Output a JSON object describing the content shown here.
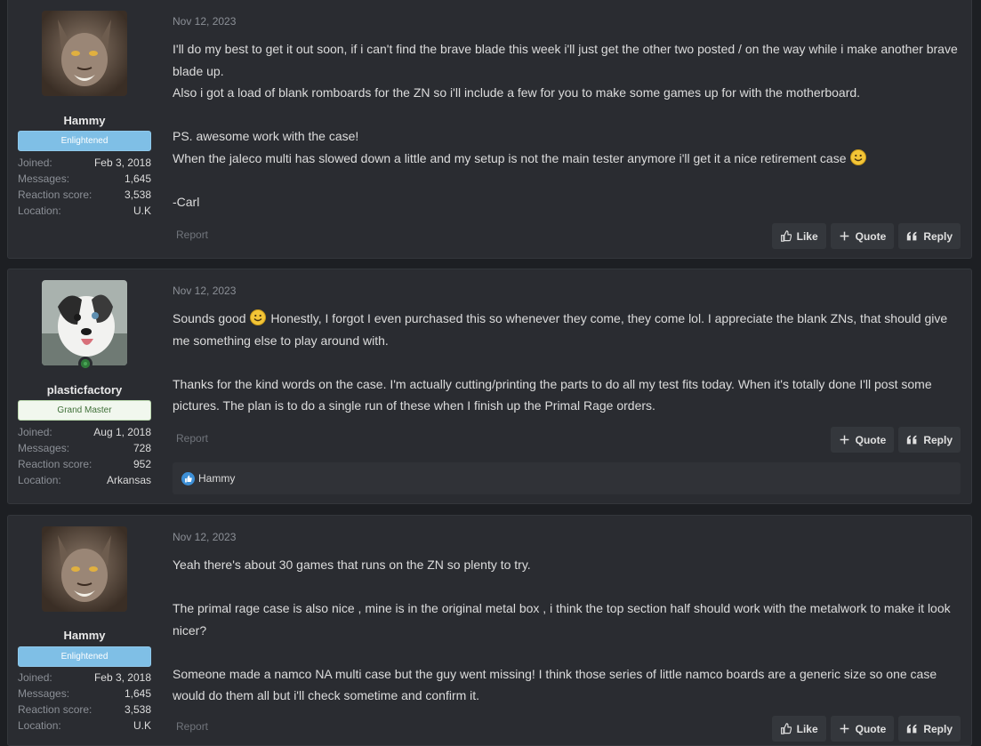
{
  "posts": [
    {
      "user": {
        "name": "Hammy",
        "banner": "Enlightened",
        "stats": [
          {
            "k": "Joined:",
            "v": "Feb 3, 2018"
          },
          {
            "k": "Messages:",
            "v": "1,645"
          },
          {
            "k": "Reaction score:",
            "v": "3,538"
          },
          {
            "k": "Location:",
            "v": "U.K"
          }
        ]
      },
      "date": "Nov 12, 2023",
      "lines": [
        "I'll do my best to get it out soon, if i can't find the brave blade this week i'll just get the other two posted / on the way while i make another brave blade up.",
        "Also i got a load of blank romboards for the ZN so i'll include a few for you to make some games up for with the motherboard.",
        "",
        "PS. awesome work with the case!",
        "When the jaleco multi has slowed down a little and my setup is not the main tester anymore i'll get it a nice retirement case",
        "",
        "-Carl"
      ],
      "report": "Report",
      "buttons": {
        "like": "Like",
        "quote": "Quote",
        "reply": "Reply"
      }
    },
    {
      "user": {
        "name": "plasticfactory",
        "banner": "Grand Master",
        "stats": [
          {
            "k": "Joined:",
            "v": "Aug 1, 2018"
          },
          {
            "k": "Messages:",
            "v": "728"
          },
          {
            "k": "Reaction score:",
            "v": "952"
          },
          {
            "k": "Location:",
            "v": "Arkansas"
          }
        ]
      },
      "date": "Nov 12, 2023",
      "line1_a": "Sounds good",
      "line1_b": "Honestly, I forgot I even purchased this so whenever they come, they come lol. I appreciate the blank ZNs, that should give me something else to play around with.",
      "para2": "Thanks for the kind words on the case. I'm actually cutting/printing the parts to do all my test fits today. When it's totally done I'll post some pictures. The plan is to do a single run of these when I finish up the Primal Rage orders.",
      "report": "Report",
      "buttons": {
        "quote": "Quote",
        "reply": "Reply"
      },
      "reaction_user": "Hammy"
    },
    {
      "user": {
        "name": "Hammy",
        "banner": "Enlightened",
        "stats": [
          {
            "k": "Joined:",
            "v": "Feb 3, 2018"
          },
          {
            "k": "Messages:",
            "v": "1,645"
          },
          {
            "k": "Reaction score:",
            "v": "3,538"
          },
          {
            "k": "Location:",
            "v": "U.K"
          }
        ]
      },
      "date": "Nov 12, 2023",
      "lines": [
        "Yeah there's about 30 games that runs on the ZN so plenty to try.",
        "",
        "The primal rage case is also nice , mine is in the original metal box , i think the top section half should work with the metalwork to make it look nicer?",
        "",
        "Someone made a namco NA multi case but the guy went missing! I think those series of little namco boards are a generic size so one case would do them all but i'll check sometime and confirm it."
      ],
      "report": "Report",
      "buttons": {
        "like": "Like",
        "quote": "Quote",
        "reply": "Reply"
      }
    }
  ]
}
